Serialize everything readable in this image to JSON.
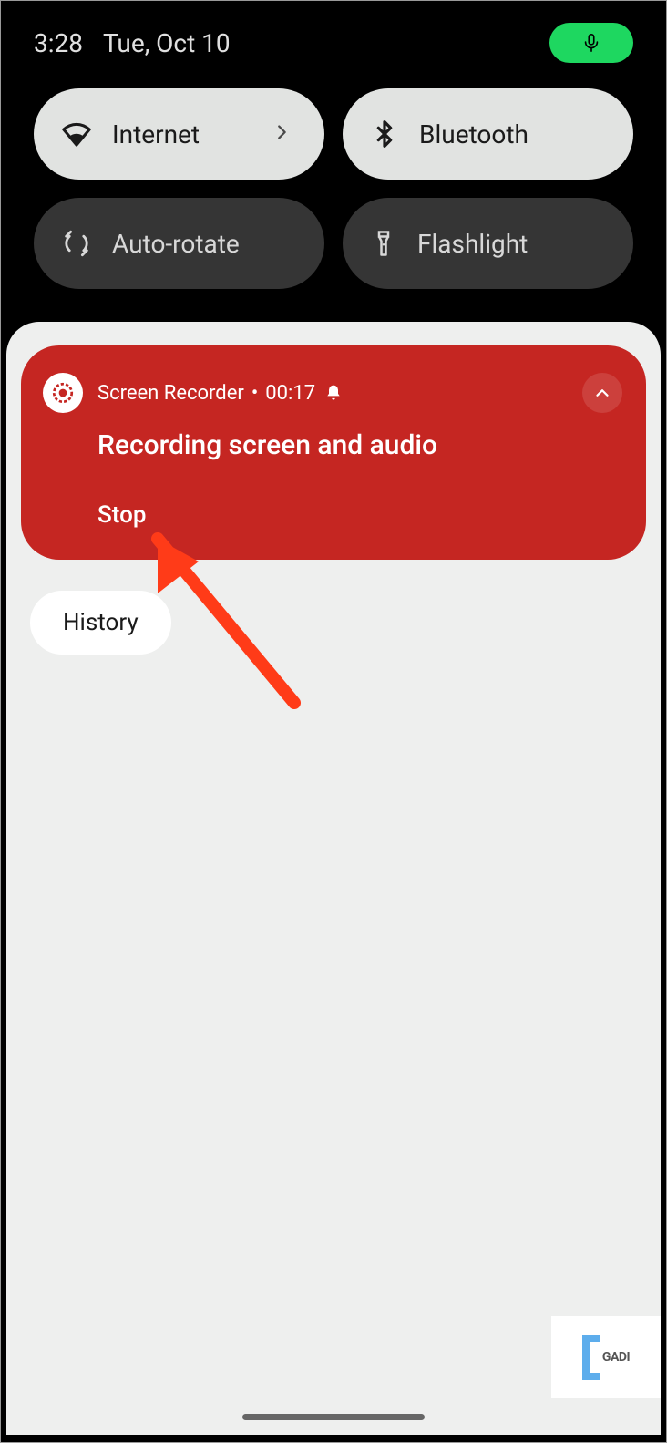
{
  "status": {
    "time": "3:28",
    "date": "Tue, Oct 10"
  },
  "quickSettings": {
    "internet": {
      "label": "Internet"
    },
    "bluetooth": {
      "label": "Bluetooth"
    },
    "autoRotate": {
      "label": "Auto-rotate"
    },
    "flashlight": {
      "label": "Flashlight"
    }
  },
  "notification": {
    "appName": "Screen Recorder",
    "separator": "•",
    "timer": "00:17",
    "title": "Recording screen and audio",
    "action": "Stop"
  },
  "history": {
    "label": "History"
  },
  "watermark": {
    "text": "GADI"
  }
}
